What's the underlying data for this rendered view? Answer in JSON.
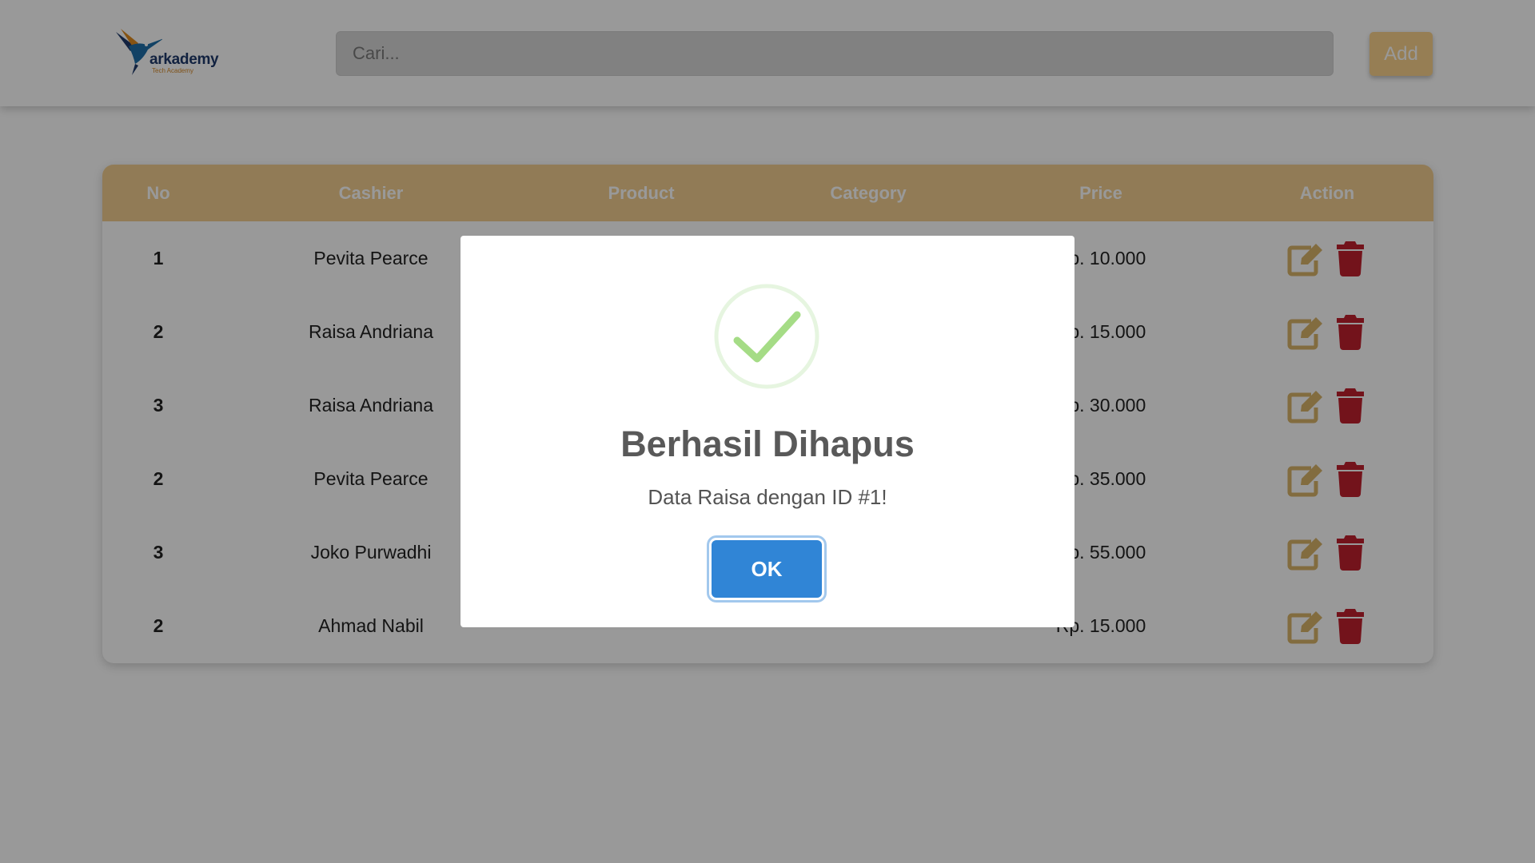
{
  "header": {
    "logo": {
      "name": "arkademy",
      "tagline": "Tech Academy"
    },
    "search": {
      "placeholder": "Cari..."
    },
    "add_label": "Add"
  },
  "table": {
    "columns": [
      "No",
      "Cashier",
      "Product",
      "Category",
      "Price",
      "Action"
    ],
    "rows": [
      {
        "no": "1",
        "cashier": "Pevita Pearce",
        "price": "Rp. 10.000"
      },
      {
        "no": "2",
        "cashier": "Raisa Andriana",
        "price": "Rp. 15.000"
      },
      {
        "no": "3",
        "cashier": "Raisa Andriana",
        "price": "Rp. 30.000"
      },
      {
        "no": "2",
        "cashier": "Pevita Pearce",
        "price": "Rp. 35.000"
      },
      {
        "no": "3",
        "cashier": "Joko Purwadhi",
        "price": "Rp. 55.000"
      },
      {
        "no": "2",
        "cashier": "Ahmad Nabil",
        "price": "Rp. 15.000"
      }
    ],
    "action_icons": [
      "edit-icon",
      "trash-icon"
    ]
  },
  "modal": {
    "icon": "success-check-icon",
    "title": "Berhasil Dihapus",
    "text": "Data Raisa dengan ID #1!",
    "ok_label": "OK"
  },
  "colors": {
    "accent": "#f2ce8f",
    "add_button": "#fbd38d",
    "edit_icon": "#d9b46a",
    "trash_icon": "#c0202e",
    "ok_button": "#3085d6",
    "success_check": "#a5dc86"
  }
}
